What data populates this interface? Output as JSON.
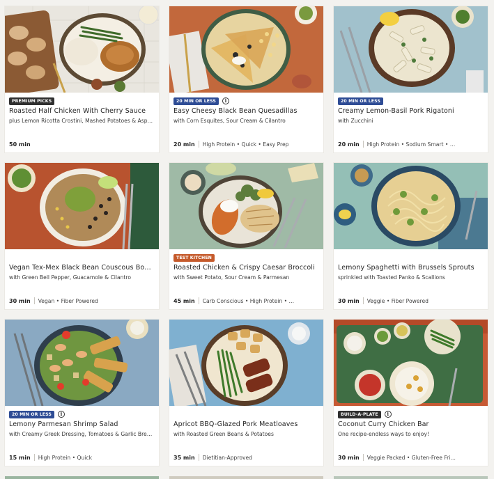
{
  "colors": {
    "badge_premium": "#2f2f2f",
    "badge_fast": "#2e4c95",
    "badge_test": "#c55a2b",
    "badge_build": "#2f2f2f"
  },
  "recipes": [
    {
      "badge": "PREMIUM PICKS",
      "badge_kind": "premium",
      "has_info": false,
      "title": "Roasted Half Chicken With Cherry Sauce",
      "subtitle": "plus Lemon Ricotta Crostini, Mashed Potatoes & Asp…",
      "time": "50 min",
      "tags": ""
    },
    {
      "badge": "20 MIN OR LESS",
      "badge_kind": "fast",
      "has_info": true,
      "title": "Easy Cheesy Black Bean Quesadillas",
      "subtitle": "with Corn Esquites, Sour Cream & Cilantro",
      "time": "20 min",
      "tags": "High Protein • Quick • Easy Prep"
    },
    {
      "badge": "20 MIN OR LESS",
      "badge_kind": "fast",
      "has_info": false,
      "title": "Creamy Lemon-Basil Pork Rigatoni",
      "subtitle": "with Zucchini",
      "time": "20 min",
      "tags": "High Protein • Sodium Smart • …"
    },
    {
      "badge": "",
      "badge_kind": "",
      "has_info": false,
      "title": "Vegan Tex-Mex Black Bean Couscous Bo…",
      "subtitle": "with Green Bell Pepper, Guacamole & Cilantro",
      "time": "30 min",
      "tags": "Vegan • Fiber Powered"
    },
    {
      "badge": "TEST KITCHEN",
      "badge_kind": "test",
      "has_info": false,
      "title": "Roasted Chicken & Crispy Caesar Broccoli",
      "subtitle": "with Sweet Potato, Sour Cream & Parmesan",
      "time": "45 min",
      "tags": "Carb Conscious • High Protein • …"
    },
    {
      "badge": "",
      "badge_kind": "",
      "has_info": false,
      "title": "Lemony Spaghetti with Brussels Sprouts",
      "subtitle": "sprinkled with Toasted Panko & Scallions",
      "time": "30 min",
      "tags": "Veggie • Fiber Powered"
    },
    {
      "badge": "20 MIN OR LESS",
      "badge_kind": "fast",
      "has_info": true,
      "title": "Lemony Parmesan Shrimp Salad",
      "subtitle": "with Creamy Greek Dressing, Tomatoes & Garlic Bre…",
      "time": "15 min",
      "tags": "High Protein • Quick"
    },
    {
      "badge": "",
      "badge_kind": "",
      "has_info": false,
      "title": "Apricot BBQ-Glazed Pork Meatloaves",
      "subtitle": "with Roasted Green Beans & Potatoes",
      "time": "35 min",
      "tags": "Dietitian-Approved"
    },
    {
      "badge": "BUILD-A-PLATE",
      "badge_kind": "build",
      "has_info": true,
      "title": "Coconut Curry Chicken Bar",
      "subtitle": "One recipe-endless ways to enjoy!",
      "time": "30 min",
      "tags": "Veggie Packed • Gluten-Free Fri…"
    }
  ]
}
